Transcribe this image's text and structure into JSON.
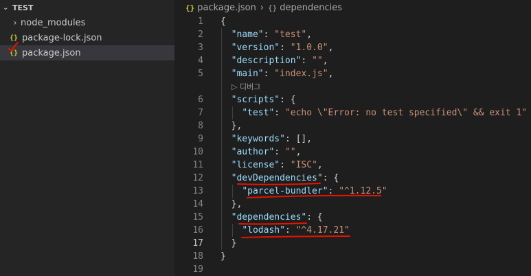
{
  "explorer": {
    "section_title": "TEST",
    "items": [
      {
        "label": "node_modules",
        "icon": "chevron-right-icon"
      },
      {
        "label": "package-lock.json",
        "icon": "json-braces-icon"
      },
      {
        "label": "package.json",
        "icon": "json-braces-icon"
      }
    ]
  },
  "breadcrumb": {
    "file": "package.json",
    "file_icon": "{}",
    "symbol": "dependencies",
    "symbol_icon": "{}"
  },
  "code_lens": "▷ 디버그",
  "lines": [
    {
      "no": "1",
      "tokens": [
        {
          "t": "p",
          "v": "{"
        }
      ]
    },
    {
      "no": "2",
      "tokens": [
        {
          "t": "p",
          "v": "  "
        },
        {
          "t": "k",
          "v": "\"name\""
        },
        {
          "t": "p",
          "v": ": "
        },
        {
          "t": "s",
          "v": "\"test\""
        },
        {
          "t": "p",
          "v": ","
        }
      ]
    },
    {
      "no": "3",
      "tokens": [
        {
          "t": "p",
          "v": "  "
        },
        {
          "t": "k",
          "v": "\"version\""
        },
        {
          "t": "p",
          "v": ": "
        },
        {
          "t": "s",
          "v": "\"1.0.0\""
        },
        {
          "t": "p",
          "v": ","
        }
      ]
    },
    {
      "no": "4",
      "tokens": [
        {
          "t": "p",
          "v": "  "
        },
        {
          "t": "k",
          "v": "\"description\""
        },
        {
          "t": "p",
          "v": ": "
        },
        {
          "t": "s",
          "v": "\"\""
        },
        {
          "t": "p",
          "v": ","
        }
      ]
    },
    {
      "no": "5",
      "tokens": [
        {
          "t": "p",
          "v": "  "
        },
        {
          "t": "k",
          "v": "\"main\""
        },
        {
          "t": "p",
          "v": ": "
        },
        {
          "t": "s",
          "v": "\"index.js\""
        },
        {
          "t": "p",
          "v": ","
        }
      ]
    },
    {
      "no": "6",
      "tokens": [
        {
          "t": "p",
          "v": "  "
        },
        {
          "t": "k",
          "v": "\"scripts\""
        },
        {
          "t": "p",
          "v": ": {"
        }
      ]
    },
    {
      "no": "7",
      "tokens": [
        {
          "t": "p",
          "v": "    "
        },
        {
          "t": "k",
          "v": "\"test\""
        },
        {
          "t": "p",
          "v": ": "
        },
        {
          "t": "s",
          "v": "\"echo \\\"Error: no test specified\\\" && exit 1\""
        }
      ]
    },
    {
      "no": "8",
      "tokens": [
        {
          "t": "p",
          "v": "  },"
        }
      ]
    },
    {
      "no": "9",
      "tokens": [
        {
          "t": "p",
          "v": "  "
        },
        {
          "t": "k",
          "v": "\"keywords\""
        },
        {
          "t": "p",
          "v": ": [],"
        }
      ]
    },
    {
      "no": "10",
      "tokens": [
        {
          "t": "p",
          "v": "  "
        },
        {
          "t": "k",
          "v": "\"author\""
        },
        {
          "t": "p",
          "v": ": "
        },
        {
          "t": "s",
          "v": "\"\""
        },
        {
          "t": "p",
          "v": ","
        }
      ]
    },
    {
      "no": "11",
      "tokens": [
        {
          "t": "p",
          "v": "  "
        },
        {
          "t": "k",
          "v": "\"license\""
        },
        {
          "t": "p",
          "v": ": "
        },
        {
          "t": "s",
          "v": "\"ISC\""
        },
        {
          "t": "p",
          "v": ","
        }
      ]
    },
    {
      "no": "12",
      "tokens": [
        {
          "t": "p",
          "v": "  "
        },
        {
          "t": "k",
          "v": "\"devDependencies\""
        },
        {
          "t": "p",
          "v": ": {"
        }
      ]
    },
    {
      "no": "13",
      "tokens": [
        {
          "t": "p",
          "v": "    "
        },
        {
          "t": "k",
          "v": "\"parcel-bundler\""
        },
        {
          "t": "p",
          "v": ": "
        },
        {
          "t": "s",
          "v": "\"^1.12.5\""
        }
      ]
    },
    {
      "no": "14",
      "tokens": [
        {
          "t": "p",
          "v": "  },"
        }
      ]
    },
    {
      "no": "15",
      "tokens": [
        {
          "t": "p",
          "v": "  "
        },
        {
          "t": "k",
          "v": "\"dependencies\""
        },
        {
          "t": "p",
          "v": ": {"
        }
      ]
    },
    {
      "no": "16",
      "tokens": [
        {
          "t": "p",
          "v": "    "
        },
        {
          "t": "k",
          "v": "\"lodash\""
        },
        {
          "t": "p",
          "v": ": "
        },
        {
          "t": "s",
          "v": "\"^4.17.21\""
        }
      ]
    },
    {
      "no": "17",
      "tokens": [
        {
          "t": "p",
          "v": "  }"
        }
      ]
    },
    {
      "no": "18",
      "tokens": [
        {
          "t": "p",
          "v": "}"
        }
      ]
    },
    {
      "no": "19",
      "tokens": []
    }
  ],
  "colors": {
    "key": "#9cdcfe",
    "string": "#ce9178",
    "punctuation": "#d4d4d4",
    "json_icon": "#cbcb41",
    "annotation": "#e51400"
  }
}
